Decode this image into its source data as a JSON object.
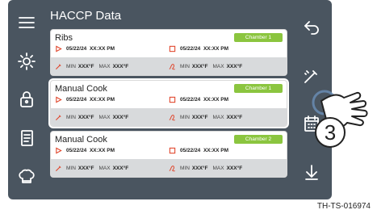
{
  "screen": {
    "title": "HACCP Data"
  },
  "records": [
    {
      "name": "Ribs",
      "chamber": "Chamber 1",
      "start": {
        "date": "05/22/24",
        "time": "XX:XX PM"
      },
      "end": {
        "date": "05/22/24",
        "time": "XX:XX PM"
      },
      "probe": {
        "min_label": "MIN",
        "min": "XXX°F",
        "max_label": "MAX",
        "max": "XXX°F"
      },
      "cavity": {
        "min_label": "MIN",
        "min": "XXX°F",
        "max_label": "MAX",
        "max": "XXX°F"
      }
    },
    {
      "name": "Manual Cook",
      "chamber": "Chamber 1",
      "start": {
        "date": "05/22/24",
        "time": "XX:XX PM"
      },
      "end": {
        "date": "05/22/24",
        "time": "XX:XX PM"
      },
      "probe": {
        "min_label": "MIN",
        "min": "XXX°F",
        "max_label": "MAX",
        "max": "XXX°F"
      },
      "cavity": {
        "min_label": "MIN",
        "min": "XXX°F",
        "max_label": "MAX",
        "max": "XXX°F"
      }
    },
    {
      "name": "Manual Cook",
      "chamber": "Chamber 2",
      "start": {
        "date": "05/22/24",
        "time": "XX:XX PM"
      },
      "end": {
        "date": "05/22/24",
        "time": "XX:XX PM"
      },
      "probe": {
        "min_label": "MIN",
        "min": "XXX°F",
        "max_label": "MAX",
        "max": "XXX°F"
      },
      "cavity": {
        "min_label": "MIN",
        "min": "XXX°F",
        "max_label": "MAX",
        "max": "XXX°F"
      }
    }
  ],
  "left_nav": [
    "menu-icon",
    "brightness-icon",
    "lock-icon",
    "recipe-book-icon",
    "chef-hat-icon"
  ],
  "right_nav": [
    "back-arrow-icon",
    "probe-icon",
    "calendar-icon",
    "download-icon"
  ],
  "callout": {
    "step": "3"
  },
  "caption": "TH-TS-016974",
  "colors": {
    "frame": "#4a5560",
    "badge": "#8bc53f",
    "start_icon": "#e0452b",
    "stop_icon": "#e0452b",
    "probe_icon": "#e0452b",
    "card_footer": "#d8dadc"
  }
}
